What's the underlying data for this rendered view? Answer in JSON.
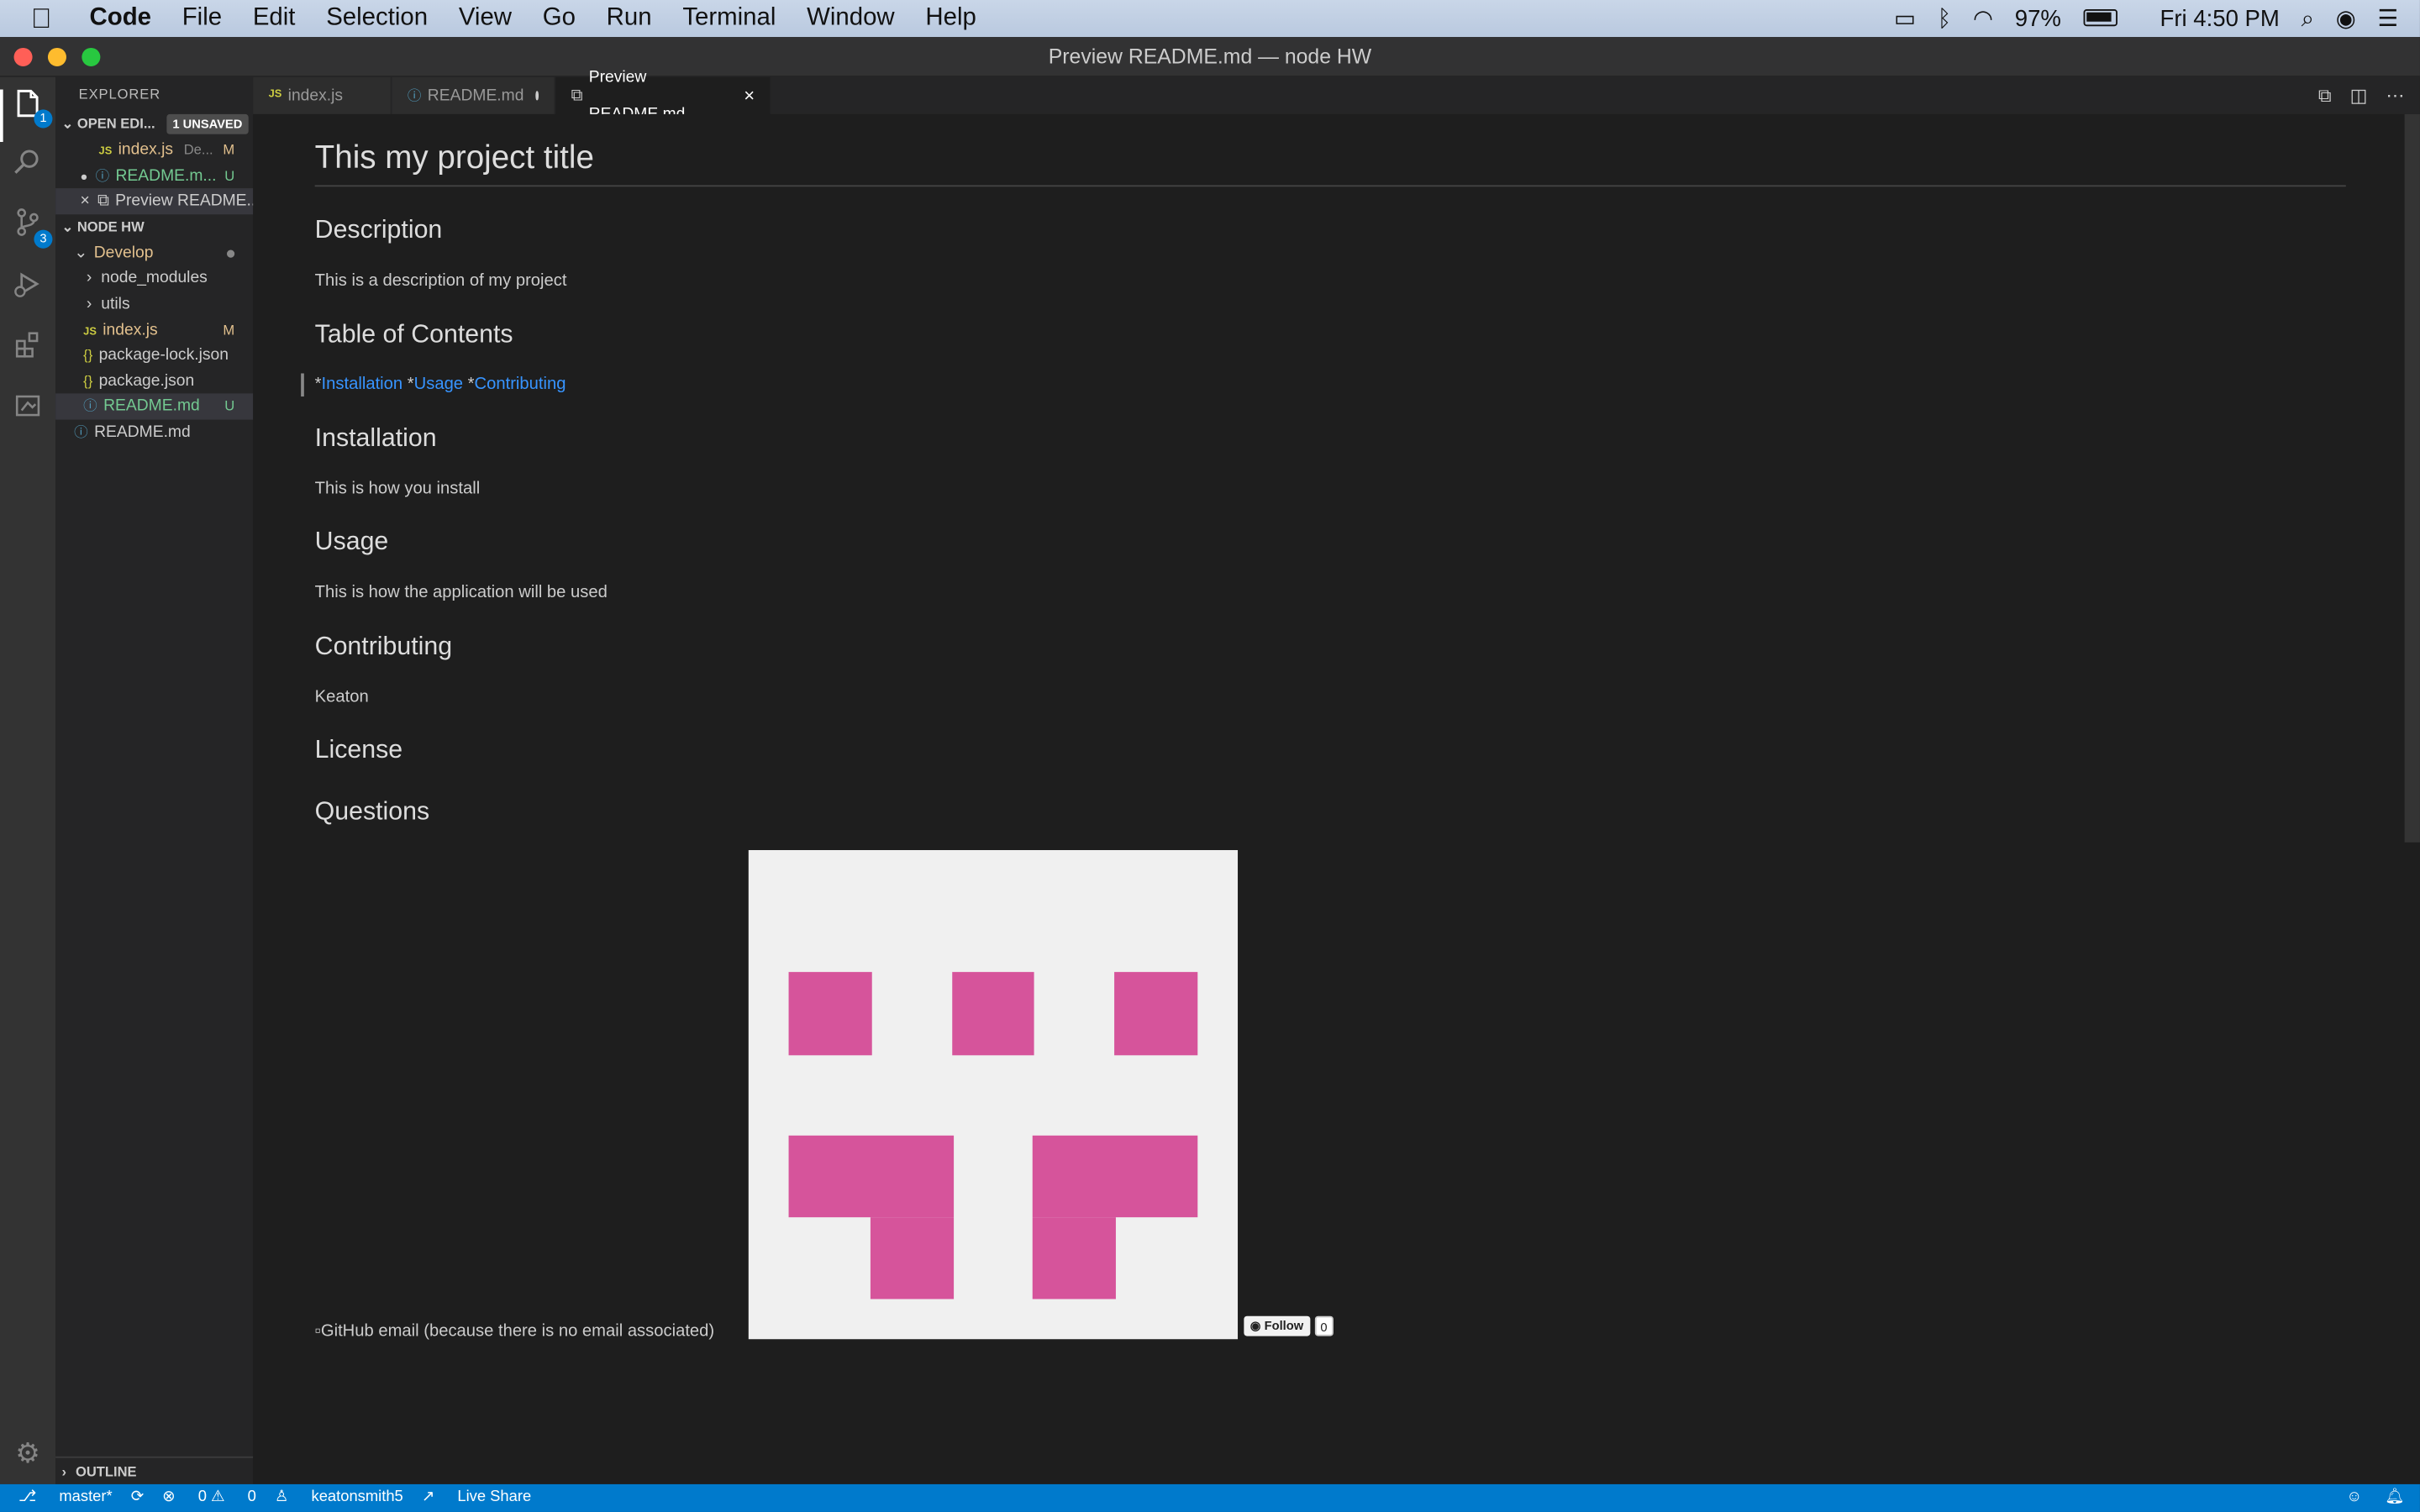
{
  "menubar": {
    "app_name": "Code",
    "items": [
      "File",
      "Edit",
      "Selection",
      "View",
      "Go",
      "Run",
      "Terminal",
      "Window",
      "Help"
    ],
    "battery": "97%",
    "clock": "Fri 4:50 PM"
  },
  "window": {
    "title": "Preview README.md — node HW"
  },
  "activity": {
    "explorer_badge": "1",
    "scm_badge": "3"
  },
  "sidebar": {
    "title": "EXPLORER",
    "open_editors": {
      "label": "OPEN EDI...",
      "unsaved": "1 UNSAVED",
      "items": [
        {
          "icon": "JS",
          "name": "index.js",
          "hint": "De...",
          "status": "M"
        },
        {
          "icon": "ⓘ",
          "name": "README.m...",
          "status": "U"
        },
        {
          "icon": "⧉",
          "name": "Preview README..."
        }
      ]
    },
    "project": {
      "label": "NODE HW",
      "folder": "Develop",
      "items": [
        {
          "name": "node_modules"
        },
        {
          "name": "utils"
        },
        {
          "name": "index.js",
          "status": "M"
        },
        {
          "name": "package-lock.json"
        },
        {
          "name": "package.json"
        },
        {
          "name": "README.md",
          "status": "U"
        }
      ],
      "root_file": "README.md"
    },
    "outline": "OUTLINE"
  },
  "tabs": [
    {
      "icon": "JS",
      "label": "index.js"
    },
    {
      "icon": "ⓘ",
      "label": "README.md"
    },
    {
      "icon": "⧉",
      "label": "Preview README.md"
    }
  ],
  "preview": {
    "title": "This my project title",
    "sections": {
      "description_h": "Description",
      "description_p": "This is a description of my project",
      "toc_h": "Table of Contents",
      "toc": [
        "Installation",
        "Usage",
        "Contributing"
      ],
      "install_h": "Installation",
      "install_p": "This is how you install",
      "usage_h": "Usage",
      "usage_p": "This is how the application will be used",
      "contrib_h": "Contributing",
      "contrib_p": "Keaton",
      "license_h": "License",
      "questions_h": "Questions"
    },
    "broken_image_alt": "GitHub email (because there is no email associated)",
    "follow_label": "Follow",
    "follow_count": "0"
  },
  "statusbar": {
    "branch": "master*",
    "errors": "0",
    "warnings": "0",
    "user": "keatonsmith5",
    "liveshare": "Live Share"
  },
  "colors": {
    "accent": "#007acc",
    "identicon_fill": "#d6549b",
    "link": "#3794ff"
  }
}
